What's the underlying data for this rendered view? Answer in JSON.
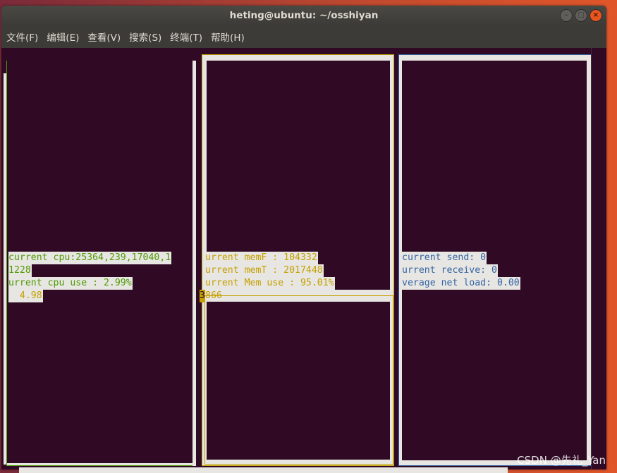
{
  "window": {
    "title": "heting@ubuntu: ~/osshiyan",
    "buttons": {
      "minimize": "–",
      "maximize": "□",
      "close": "×"
    }
  },
  "menu": [
    "文件(F)",
    "编辑(E)",
    "查看(V)",
    "搜索(S)",
    "终端(T)",
    "帮助(H)"
  ],
  "cpu_panel": {
    "lines": [
      "current cpu:25364,239,17040,1",
      "1228",
      "urrent cpu use : 2.99%",
      "  4.98"
    ]
  },
  "mem_panel": {
    "lines": [
      "urrent memF : 104332",
      "urrent memT : 2017448",
      "urrent Mem use : 95.01%"
    ],
    "cursor_char": "3",
    "tail": "866"
  },
  "net_panel": {
    "lines": [
      "current send: 0",
      "urrent receive: 0",
      "verage net load: 0.00"
    ]
  },
  "colors": {
    "terminal_bg": "#300a24",
    "fill": "#e8e6e2",
    "cpu": "#4e9a06",
    "mem": "#c4a000",
    "net": "#3465a4"
  },
  "watermark": "CSDN @先礼_Yan"
}
